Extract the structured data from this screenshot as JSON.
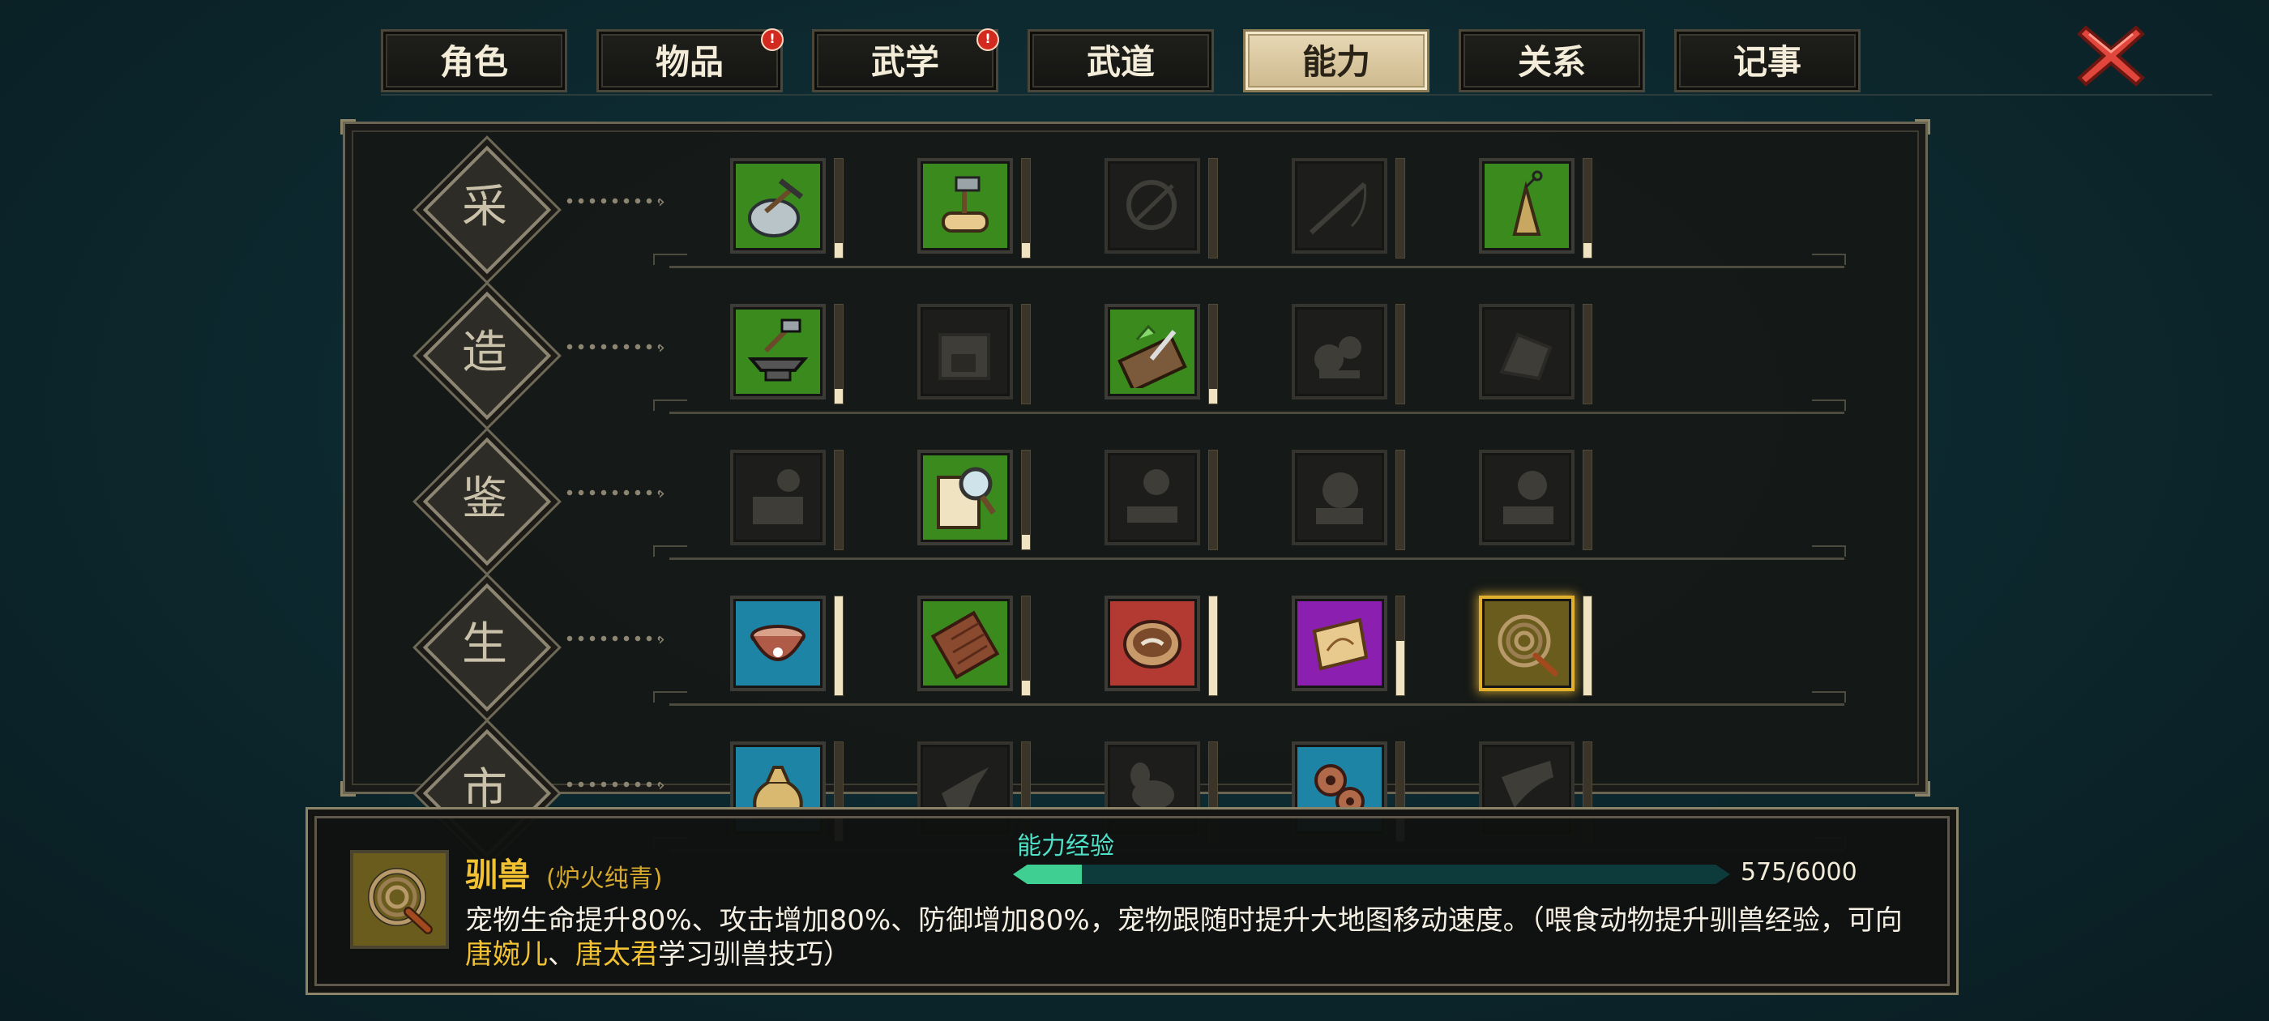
{
  "tabs": [
    {
      "label": "角色",
      "badge": false,
      "active": false
    },
    {
      "label": "物品",
      "badge": true,
      "active": false
    },
    {
      "label": "武学",
      "badge": true,
      "active": false
    },
    {
      "label": "武道",
      "badge": false,
      "active": false
    },
    {
      "label": "能力",
      "badge": false,
      "active": true
    },
    {
      "label": "关系",
      "badge": false,
      "active": false
    },
    {
      "label": "记事",
      "badge": false,
      "active": false
    }
  ],
  "badge_glyph": "!",
  "close_icon": "close-x-icon",
  "rows": [
    {
      "label": "采",
      "skills": [
        {
          "icon": "mining-pick-icon",
          "bg": "#3a8a1e",
          "locked": false,
          "level": 0.15
        },
        {
          "icon": "lumber-axe-icon",
          "bg": "#3a8a1e",
          "locked": false,
          "level": 0.15
        },
        {
          "icon": "fishing-net-icon",
          "bg": "#1d1d1b",
          "locked": true,
          "level": 0
        },
        {
          "icon": "fishing-rod-icon",
          "bg": "#1d1d1b",
          "locked": true,
          "level": 0
        },
        {
          "icon": "yarn-spindle-icon",
          "bg": "#3a8a1e",
          "locked": false,
          "level": 0.15
        }
      ]
    },
    {
      "label": "造",
      "skills": [
        {
          "icon": "anvil-hammer-icon",
          "bg": "#3a8a1e",
          "locked": false,
          "level": 0.15
        },
        {
          "icon": "furnace-icon",
          "bg": "#1d1d1b",
          "locked": true,
          "level": 0
        },
        {
          "icon": "cutting-board-knife-icon",
          "bg": "#3a8a1e",
          "locked": false,
          "level": 0.15
        },
        {
          "icon": "herb-grinder-icon",
          "bg": "#1d1d1b",
          "locked": true,
          "level": 0
        },
        {
          "icon": "stone-carving-icon",
          "bg": "#1d1d1b",
          "locked": true,
          "level": 0
        }
      ]
    },
    {
      "label": "鉴",
      "skills": [
        {
          "icon": "appraise-book-icon",
          "bg": "#1d1d1b",
          "locked": true,
          "level": 0
        },
        {
          "icon": "magnify-scroll-icon",
          "bg": "#3a8a1e",
          "locked": false,
          "level": 0.15
        },
        {
          "icon": "appraise-stand-icon",
          "bg": "#1d1d1b",
          "locked": true,
          "level": 0
        },
        {
          "icon": "appraise-bell-icon",
          "bg": "#1d1d1b",
          "locked": true,
          "level": 0
        },
        {
          "icon": "appraise-lens-icon",
          "bg": "#1d1d1b",
          "locked": true,
          "level": 0
        }
      ]
    },
    {
      "label": "生",
      "skills": [
        {
          "icon": "bowl-icon",
          "bg": "#1e84a6",
          "locked": false,
          "level": 1.0
        },
        {
          "icon": "chocolate-bar-icon",
          "bg": "#3a8a1e",
          "locked": false,
          "level": 0.15
        },
        {
          "icon": "healing-bowl-icon",
          "bg": "#b23a32",
          "locked": false,
          "level": 1.0
        },
        {
          "icon": "treasure-map-icon",
          "bg": "#8b1fb0",
          "locked": false,
          "level": 0.55
        },
        {
          "icon": "whip-icon",
          "bg": "#6a5c1d",
          "locked": false,
          "level": 1.0,
          "selected": true
        }
      ]
    },
    {
      "label": "市",
      "skills": [
        {
          "icon": "money-bag-icon",
          "bg": "#1e84a6",
          "locked": false,
          "level": 0.3
        },
        {
          "icon": "pointing-hand-icon",
          "bg": "#1d1d1b",
          "locked": true,
          "level": 0
        },
        {
          "icon": "mortar-icon",
          "bg": "#1d1d1b",
          "locked": true,
          "level": 0
        },
        {
          "icon": "gears-icon",
          "bg": "#1e84a6",
          "locked": false,
          "level": 0.3
        },
        {
          "icon": "horn-icon",
          "bg": "#1d1d1b",
          "locked": true,
          "level": 0
        }
      ]
    }
  ],
  "detail": {
    "name": "驯兽",
    "rank": "(炉火纯青)",
    "exp_label": "能力经验",
    "exp_current": 575,
    "exp_max": 6000,
    "exp_text": "575/6000",
    "desc_part1": "宠物生命提升80%、攻击增加80%、防御增加80%，宠物跟随时提升大地图移动速度。（喂食动物提升驯兽经验，可向",
    "npc1": "唐婉儿",
    "sep": "、",
    "npc2": "唐太君",
    "desc_part2": "学习驯兽技巧）"
  }
}
